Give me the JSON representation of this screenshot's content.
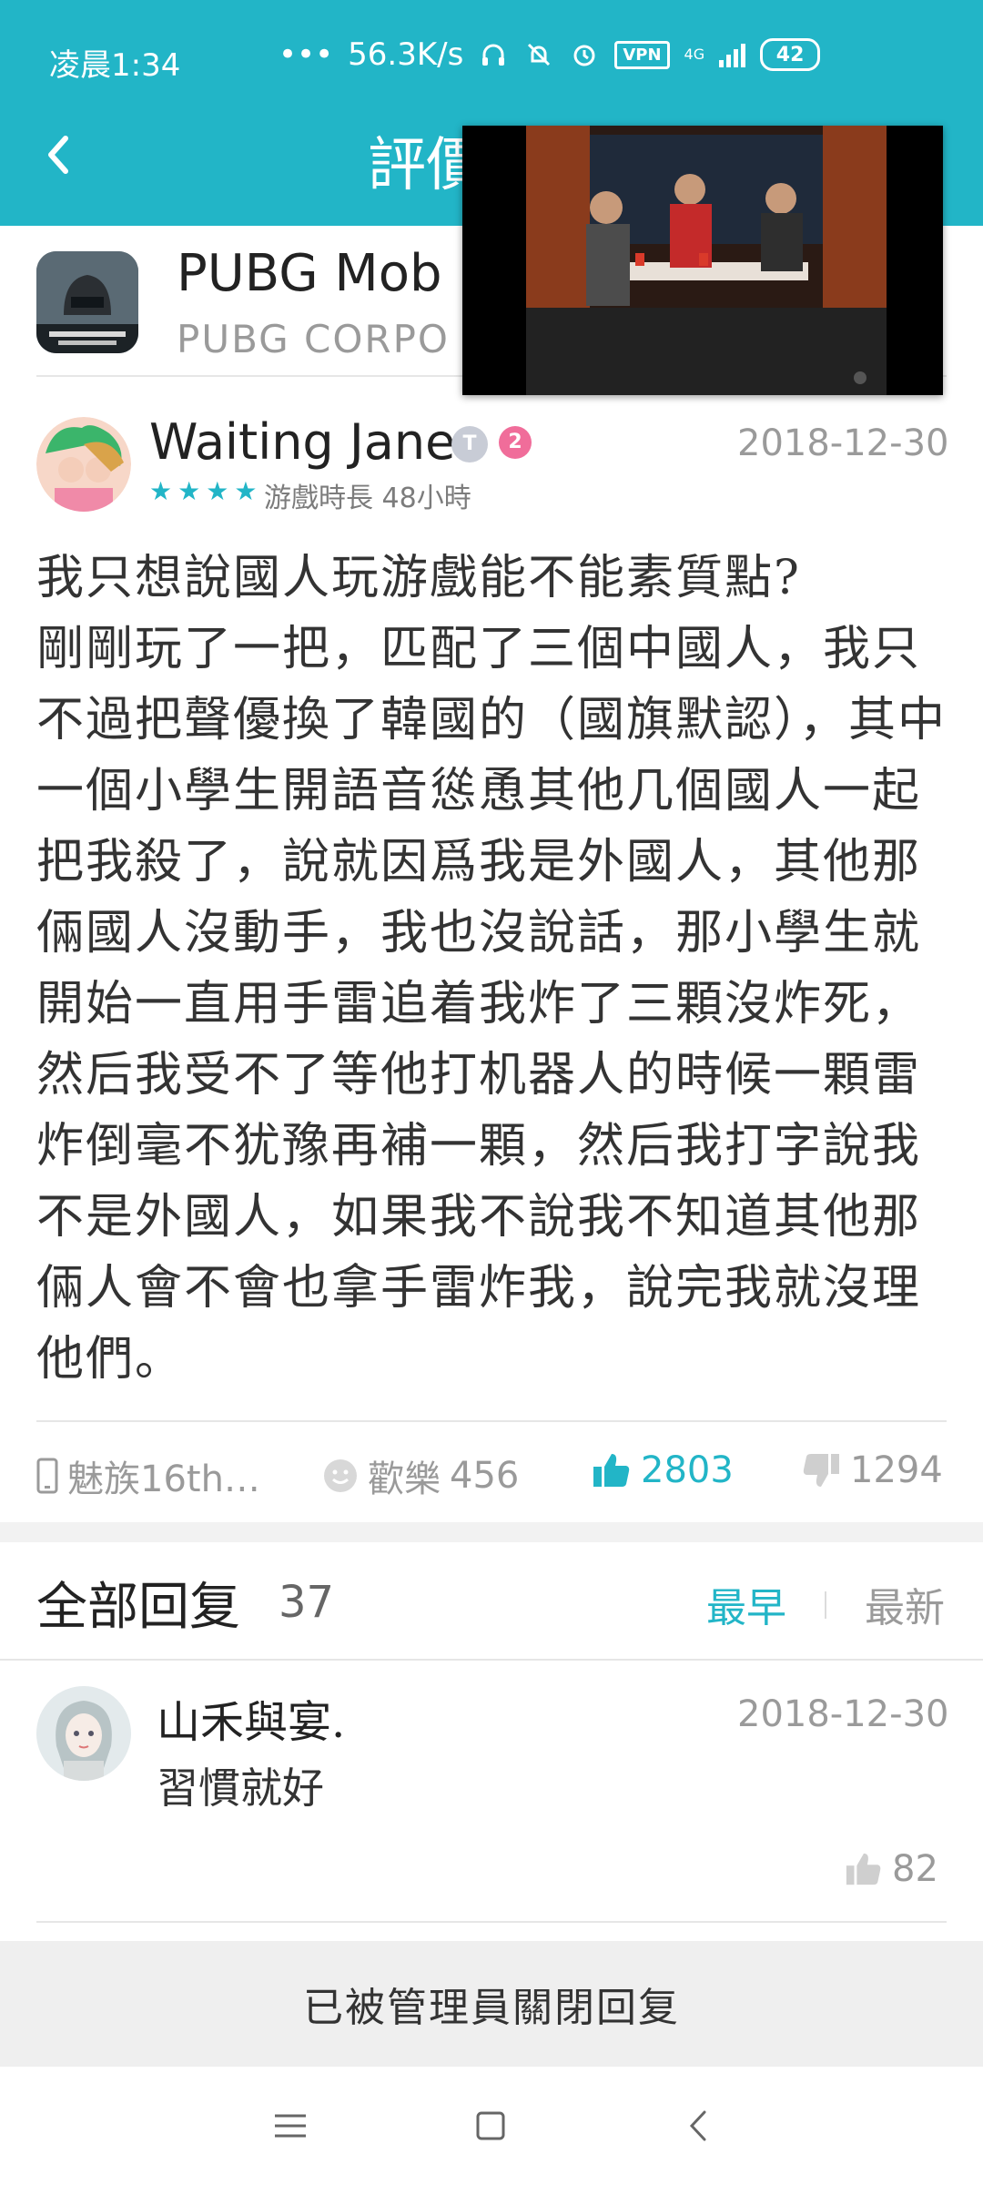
{
  "status_bar": {
    "time": "凌晨1:34",
    "speed": "56.3K/s",
    "vpn": "VPN",
    "network": "4G",
    "battery": "42"
  },
  "header": {
    "title": "評價"
  },
  "app": {
    "name": "PUBG Mob",
    "company": "PUBG CORPO"
  },
  "review": {
    "user": "Waiting Jane",
    "badge_t": "T",
    "badge_num": "2",
    "date": "2018-12-30",
    "stars": 4,
    "playtime": "游戲時長 48小時",
    "text": "我只想說國人玩游戲能不能素質點?\n剛剛玩了一把，匹配了三個中國人，我只不過把聲優換了韓國的（國旗默認），其中一個小學生開語音慫恿其他几個國人一起把我殺了，說就因爲我是外國人，其他那倆國人沒動手，我也沒說話，那小學生就開始一直用手雷追着我炸了三顆沒炸死，然后我受不了等他打机器人的時候一顆雷炸倒毫不犹豫再補一顆，然后我打字說我不是外國人，如果我不說我不知道其他那倆人會不會也拿手雷炸我，說完我就沒理他們。",
    "device": "魅族16th…",
    "fun_label": "歡樂",
    "fun_count": "456",
    "likes": "2803",
    "dislikes": "1294"
  },
  "replies": {
    "title": "全部回复",
    "count": "37",
    "sort_earliest": "最早",
    "sort_latest": "最新",
    "items": [
      {
        "user": "山禾與宴.",
        "date": "2018-12-30",
        "text": "習慣就好",
        "likes": "82"
      }
    ]
  },
  "closed_notice": "已被管理員關閉回复",
  "colors": {
    "accent": "#22b5c7",
    "muted": "#9a9a9a"
  }
}
